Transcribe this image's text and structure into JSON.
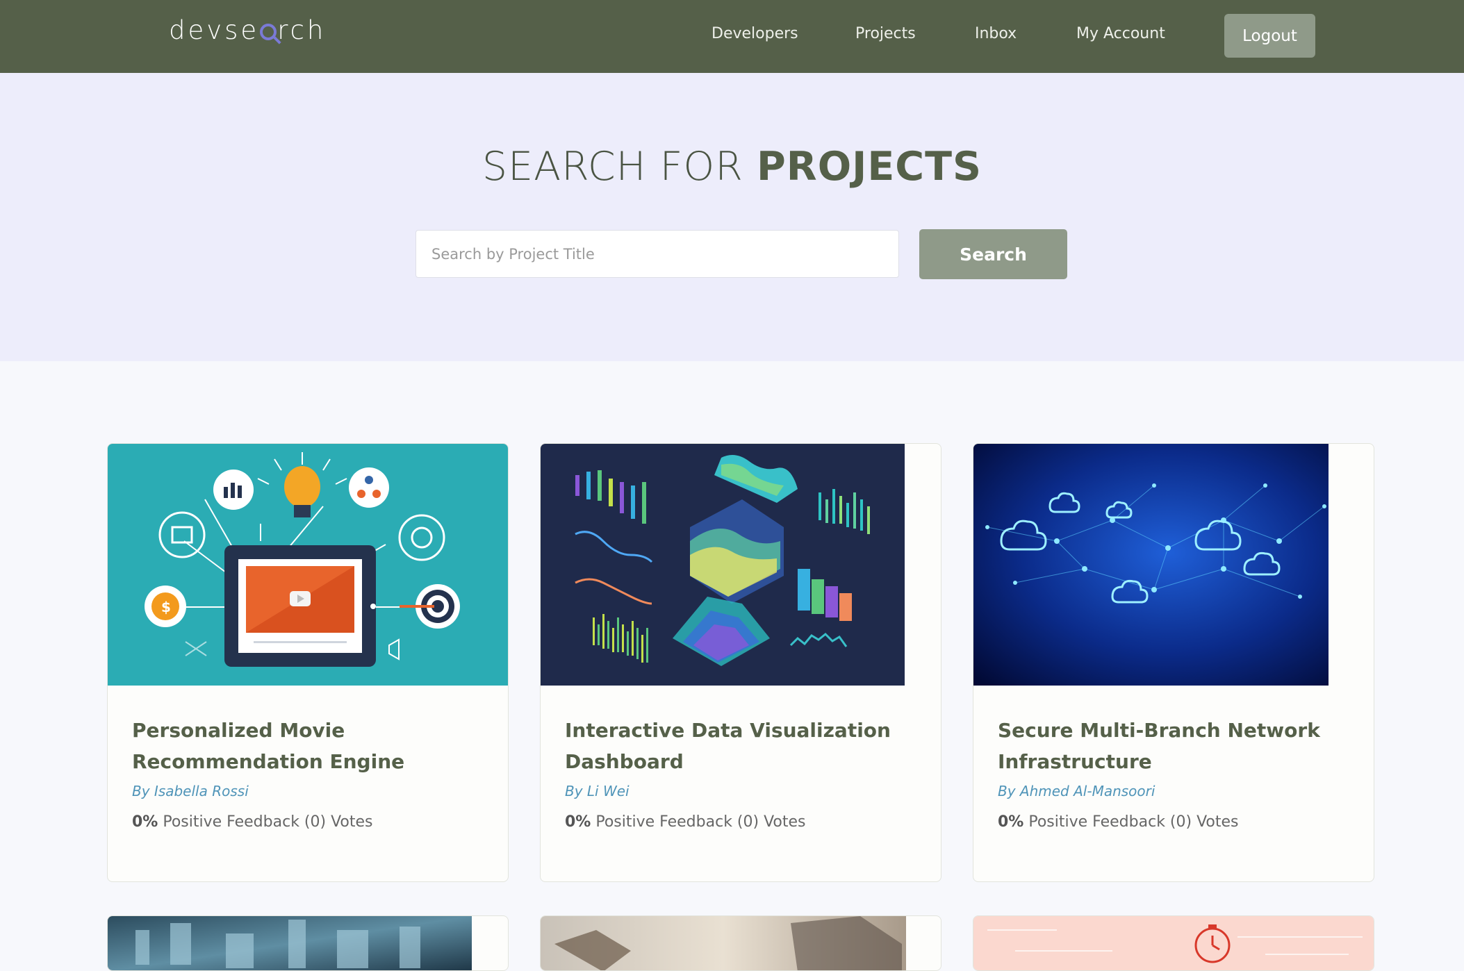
{
  "header": {
    "logo": {
      "before": "devse",
      "after": "rch"
    },
    "nav": [
      "Developers",
      "Projects",
      "Inbox",
      "My Account"
    ],
    "logout_label": "Logout"
  },
  "hero": {
    "title_prefix": "SEARCH FOR ",
    "title_strong": "PROJECTS",
    "search_placeholder": "Search by Project Title",
    "search_button": "Search"
  },
  "projects": [
    {
      "title": "Personalized Movie Recommendation Engine",
      "author": "By Isabella Rossi",
      "feedback_pct": "0%",
      "feedback_text": "Positive Feedback (0) Votes"
    },
    {
      "title": "Interactive Data Visualization Dashboard",
      "author": "By Li Wei",
      "feedback_pct": "0%",
      "feedback_text": "Positive Feedback (0) Votes"
    },
    {
      "title": "Secure Multi-Branch Network Infrastructure",
      "author": "By Ahmed Al-Mansoori",
      "feedback_pct": "0%",
      "feedback_text": "Positive Feedback (0) Votes"
    }
  ],
  "colors": {
    "header_bg": "#556049",
    "hero_bg": "#ededfb",
    "accent_button": "#8f9a89",
    "title_green": "#556049",
    "author_blue": "#4f94b8"
  }
}
